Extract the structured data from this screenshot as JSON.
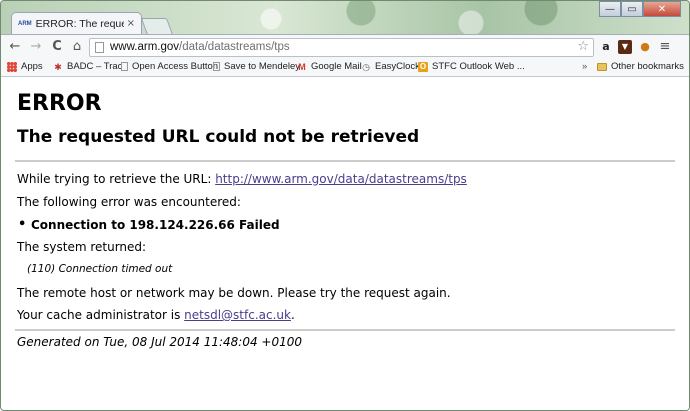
{
  "tab": {
    "favicon": "ARM",
    "title": "ERROR: The requested UR",
    "close": "×"
  },
  "window": {
    "minimize": "—",
    "maximize": "▭",
    "close": "✕"
  },
  "toolbar": {
    "back": "←",
    "forward": "→",
    "reload": "C",
    "home": "⌂",
    "menu": "≡"
  },
  "address": {
    "host": "www.arm.gov",
    "path": "/data/datastreams/tps"
  },
  "bookmarks": [
    {
      "label": "Apps",
      "icon": "apps-icon"
    },
    {
      "label": "BADC – Trac",
      "icon": "trac-icon"
    },
    {
      "label": "Open Access Button",
      "icon": "page-icon"
    },
    {
      "label": "Save to Mendeley",
      "icon": "page-icon"
    },
    {
      "label": "Google Mail",
      "icon": "gmail-icon"
    },
    {
      "label": "EasyClock",
      "icon": "clock-icon"
    },
    {
      "label": "STFC Outlook Web ...",
      "icon": "outlook-icon"
    }
  ],
  "bookmarks_more": "»",
  "other_bookmarks": "Other bookmarks",
  "page": {
    "heading": "ERROR",
    "subheading": "The requested URL could not be retrieved",
    "retrieve_text": "While trying to retrieve the URL: ",
    "retrieve_url": "http://www.arm.gov/data/datastreams/tps",
    "encountered": "The following error was encountered:",
    "error_item": "Connection to 198.124.226.66 Failed",
    "system_returned": "The system returned:",
    "system_message": "(110) Connection timed out",
    "remote_host": "The remote host or network may be down. Please try the request again.",
    "cache_admin_text": "Your cache administrator is ",
    "cache_admin_email": "netsdl@stfc.ac.uk",
    "cache_admin_end": ".",
    "generated": "Generated on Tue, 08 Jul 2014 11:48:04 +0100"
  }
}
